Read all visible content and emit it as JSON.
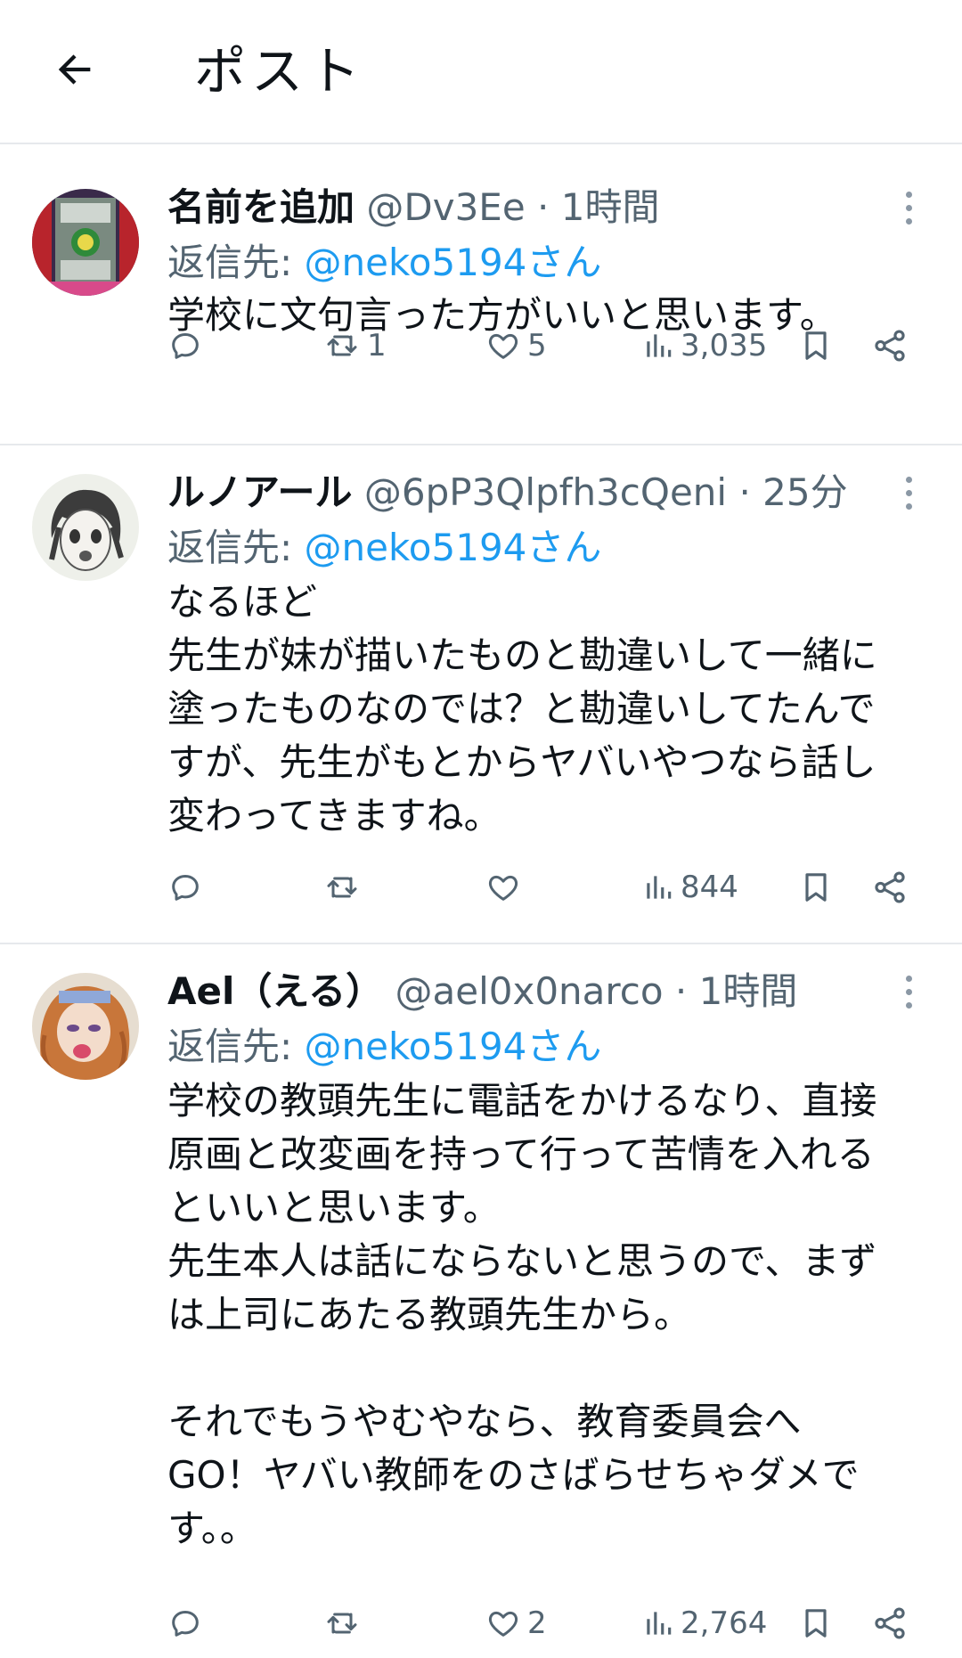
{
  "header": {
    "title": "ポスト"
  },
  "colors": {
    "accent": "#1d9bf0",
    "secondary_text": "#536471",
    "divider": "#e6e9ec"
  },
  "posts": [
    {
      "display_name": "名前を追加",
      "handle": "@Dv3Ee",
      "separator": "·",
      "time": "1時間",
      "reply_prefix": "返信先:",
      "reply_mention": "@neko5194さん",
      "body": [
        "学校に文句言った方がいいと思います。"
      ],
      "stats": {
        "replies": "",
        "reposts": "1",
        "likes": "5",
        "views": "3,035"
      }
    },
    {
      "display_name": "ルノアール",
      "handle": "@6pP3Qlpfh3cQeni",
      "separator": "·",
      "time": "25分",
      "reply_prefix": "返信先:",
      "reply_mention": "@neko5194さん",
      "body": [
        "なるほど",
        "先生が妹が描いたものと勘違いして一緒に",
        "塗ったものなのでは？と勘違いしてたんで",
        "すが、先生がもとからヤバいやつなら話し",
        "変わってきますね。"
      ],
      "stats": {
        "replies": "",
        "reposts": "",
        "likes": "",
        "views": "844"
      }
    },
    {
      "display_name": "Ael（える）",
      "handle": "@ael0x0narco",
      "separator": "·",
      "time": "1時間",
      "reply_prefix": "返信先:",
      "reply_mention": "@neko5194さん",
      "body": [
        "学校の教頭先生に電話をかけるなり、直接",
        "原画と改変画を持って行って苦情を入れる",
        "といいと思います。",
        "先生本人は話にならないと思うので、まず",
        "は上司にあたる教頭先生から。",
        "",
        "それでもうやむやなら、教育委員会へ",
        "GO！ヤバい教師をのさばらせちゃダメで",
        "す。。"
      ],
      "stats": {
        "replies": "",
        "reposts": "",
        "likes": "2",
        "views": "2,764"
      }
    }
  ]
}
